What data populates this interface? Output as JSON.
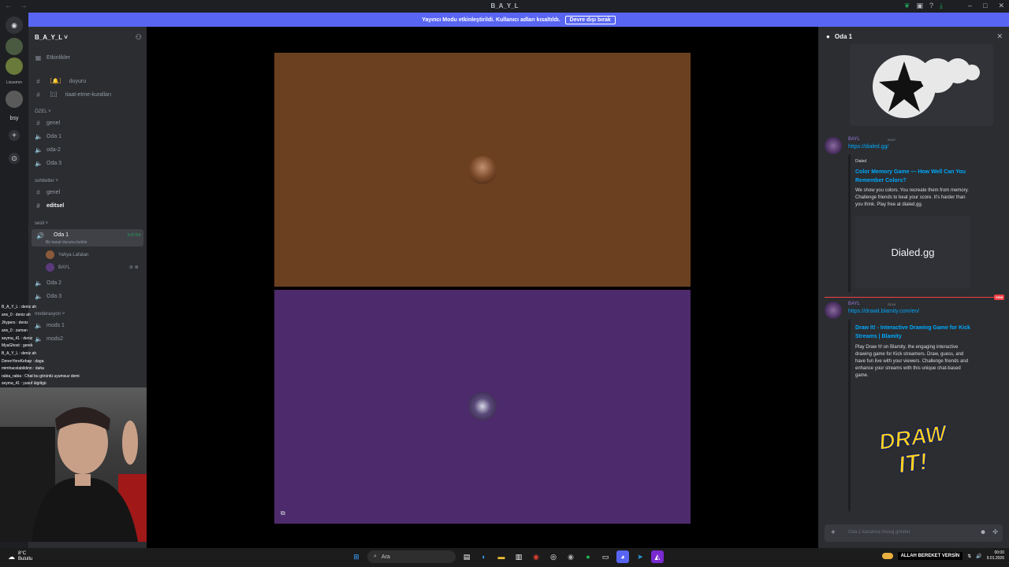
{
  "window": {
    "title": "B_A_Y_L"
  },
  "banner": {
    "text": "Yayıncı Modu etkinleştirildi. Kullanıcı adları kısaltıldı.",
    "button": "Devre dışı bırak"
  },
  "servers": {
    "label_1": "Lixusmın",
    "label_2": "bsy"
  },
  "guild": {
    "name": "B_A_Y_L"
  },
  "sidebar": {
    "events": "Etkinlikler",
    "ch_duyuru": "duyuru",
    "ch_kurallar": "itaat-etme-kuralları",
    "cat_ozel": "ÖZEL",
    "ch_genel": "genel",
    "ch_oda1": "Oda 1",
    "ch_oda2": "oda-2",
    "ch_oda3": "Oda 3",
    "cat_sohbetler": "sohbetler",
    "ch_genel2": "genel",
    "ch_editsel": "editsel",
    "cat_sesli": "sesli",
    "voice_name": "Oda 1",
    "voice_status": "Bir kanal durumu belirle",
    "voice_time": "3:47:54",
    "user1": "Yahya Lafatan",
    "user2": "BAYL",
    "ch_oda2b": "Oda 2",
    "ch_oda3b": "Oda 3",
    "cat_mod": "moderasyon",
    "ch_mods1": "mods 1",
    "ch_mods2": "mods2"
  },
  "chat_overlay": [
    "B_A_Y_L : deniz ah",
    "arw_0 : deniz ah",
    "Jhypers : deniz",
    "arw_0 : zaman",
    "seyma_41 : deniz",
    "MyaGhost : gerek",
    "B_A_Y_L : deniz ah",
    "DerenYoreKebap : daga",
    "mimhacolabildinn : daha",
    "rabia_rabia : Chat bu görüntü uyumsuz demi",
    "seyma_41 : yusuf ülgölgü"
  ],
  "right_panel": {
    "title": "Oda 1",
    "msg1": {
      "name": "BAYL",
      "time": "23:07",
      "link": "https://dialed.gg/",
      "provider": "Dialed",
      "title": "Color Memory Game — How Well Can You Remember Colors?",
      "desc": "We show you colors. You recreate them from memory. Challenge friends to beat your score. It's harder than you think. Play free at dialed.gg.",
      "image_text": "Dialed.gg"
    },
    "new_tag": "YENİ",
    "msg2": {
      "name": "BAYL",
      "time": "23:16",
      "link": "https://drawit.blamity.com/en/",
      "title": "Draw It! - Interactive Drawing Game for Kick Streams | Blamity",
      "desc": "Play Draw It! on Blamity, the engaging interactive drawing game for Kick streamers. Draw, guess, and have fun live with your viewers. Challenge friends and enhance your streams with this unique chat-based game.",
      "image_text_1": "DRAW",
      "image_text_2": "IT!"
    },
    "composer_placeholder": "Oda 1 kanalına mesaj gönder"
  },
  "taskbar": {
    "temp": "8°C",
    "weather": "Bulutlu",
    "search": "Ara",
    "marquee": "ALLAH BEREKET VERSİN",
    "time": "00:00",
    "date": "9.01.2026"
  }
}
